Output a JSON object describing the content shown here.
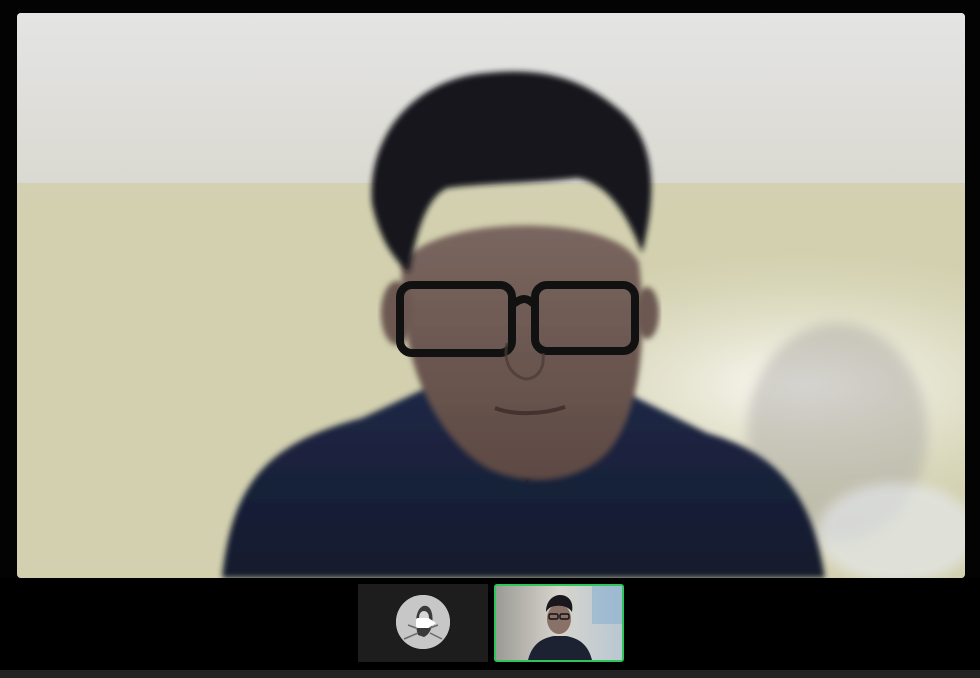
{
  "meeting": {
    "active_speaker_view": "active-speaker",
    "active_speaker_video": "participant-camera-feed",
    "thumbnail_strip": [
      {
        "type": "avatar",
        "video_on": false,
        "icon": "camera-off-icon"
      },
      {
        "type": "video",
        "video_on": true,
        "highlighted": true
      }
    ]
  },
  "colors": {
    "background": "#030303",
    "tile_background": "#1d1d1d",
    "active_border": "#2ec65a",
    "bottom_bar": "#232323"
  }
}
